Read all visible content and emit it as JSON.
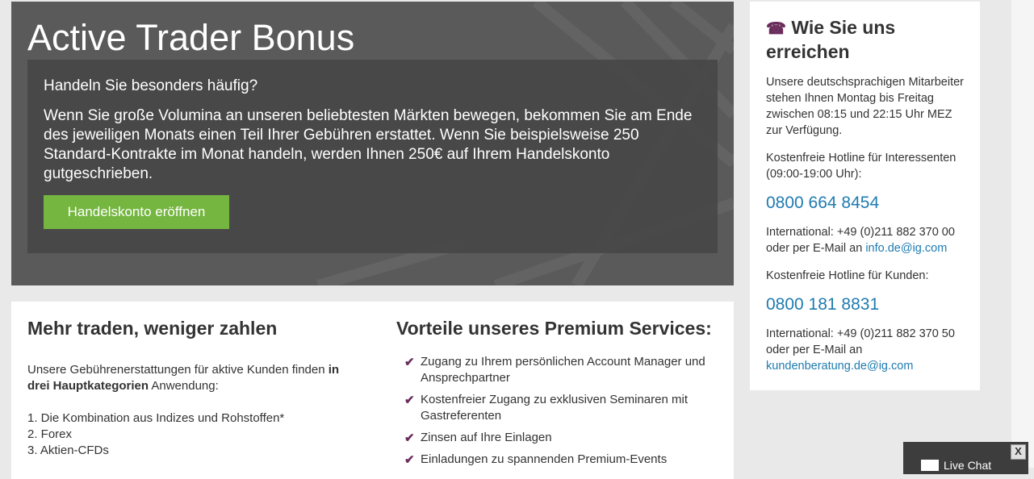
{
  "hero": {
    "title": "Active Trader Bonus",
    "question": "Handeln Sie besonders häufig?",
    "text": "Wenn Sie große Volumina an unseren beliebtesten Märkten bewegen, bekommen Sie am Ende des jeweiligen Monats einen Teil Ihrer Gebühren erstattet. Wenn Sie beispielsweise 250 Standard-Kontrakte im Monat handeln, werden Ihnen 250€ auf Ihrem Handelskonto gutgeschrieben.",
    "cta_label": "Handelskonto eröffnen"
  },
  "left": {
    "heading": "Mehr traden, weniger zahlen",
    "intro_start": "Unsere Gebührenerstattungen für aktive Kunden finden ",
    "intro_bold": "in drei Hauptkategorien",
    "intro_end": " Anwendung:",
    "categories": [
      "1. Die Kombination aus Indizes und Rohstoffen*",
      "2. Forex",
      "3. Aktien-CFDs"
    ]
  },
  "right": {
    "heading": "Vorteile unseres Premium Services:",
    "check_glyph": "✔",
    "benefits": [
      "Zugang zu Ihrem persönlichen Account Manager und Ansprechpartner",
      "Kostenfreier Zugang zu exklusiven Seminaren mit Gastreferenten",
      "Zinsen auf Ihre Einlagen",
      "Einladungen zu spannenden Premium-Events"
    ]
  },
  "contact": {
    "icon": "☎",
    "heading": "Wie Sie uns erreichen",
    "hours": "Unsere deutschsprachigen Mitarbeiter stehen Ihnen Montag bis Freitag zwischen 08:15 und 22:15 Uhr MEZ zur Verfügung.",
    "prospects_label": "Kostenfreie Hotline für Interessenten (09:00-19:00 Uhr):",
    "prospects_phone": "0800 664 8454",
    "prospects_intl": "International: +49 (0)211 882 370 00 oder per E-Mail an ",
    "prospects_email": "info.de@ig.com",
    "clients_label": "Kostenfreie Hotline für Kunden:",
    "clients_phone": "0800 181 8831",
    "clients_intl": "International: +49 (0)211 882 370 50 oder per E-Mail an ",
    "clients_email": "kundenberatung.de@ig.com"
  },
  "chat": {
    "label": "Live Chat",
    "close": "X"
  },
  "colors": {
    "accent_green": "#74b63f",
    "brand_purple": "#6a2c5b",
    "link_blue": "#1e7bb0"
  }
}
